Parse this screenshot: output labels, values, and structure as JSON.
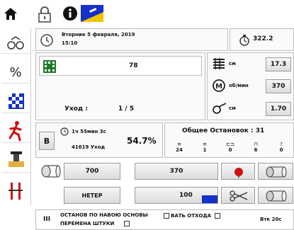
{
  "header": {
    "date_line": "Вторник  5 февраля, 2019",
    "time": "15:10",
    "counter": "322.2"
  },
  "production": {
    "shift_value": "78",
    "order_label": "Уход :",
    "order_value": "1 / 5",
    "right_rows": [
      {
        "unit": "см",
        "value": "17.3"
      },
      {
        "unit": "об/мин",
        "value": "370"
      },
      {
        "unit": "см",
        "value": "1.70"
      }
    ]
  },
  "shift_panel": {
    "letter": "B",
    "time": "1ч 55мин 3с",
    "speed": "41619 Уход",
    "efficiency": "54.7%",
    "stops_label": "Общее Остановок : 31",
    "stop_counts": [
      {
        "icon": "≋",
        "value": "24"
      },
      {
        "icon": "≋",
        "value": "1"
      },
      {
        "icon": "⊏⊐",
        "value": "0"
      },
      {
        "icon": "⊓",
        "value": "6"
      },
      {
        "icon": "?",
        "value": "0"
      }
    ]
  },
  "bottom": {
    "left_value": "700",
    "reset_label": "НЕТЕР",
    "mid_value_top": "370",
    "mid_value_bottom": "100"
  },
  "footer": {
    "roman": "III",
    "line1": "ОСТАНОВ ПО НАВОЮ ОСНОВЫ",
    "line2": "ПЕРЕМЕНА ШТУКИ",
    "checkbox1": "ВАТЬ ОТХОДА",
    "right_text": "Втк 20с"
  },
  "colors": {
    "accent_green": "#1f7a2a",
    "accent_blue": "#1530c8",
    "accent_red": "#d01010",
    "accent_yellow": "#f2c200"
  }
}
